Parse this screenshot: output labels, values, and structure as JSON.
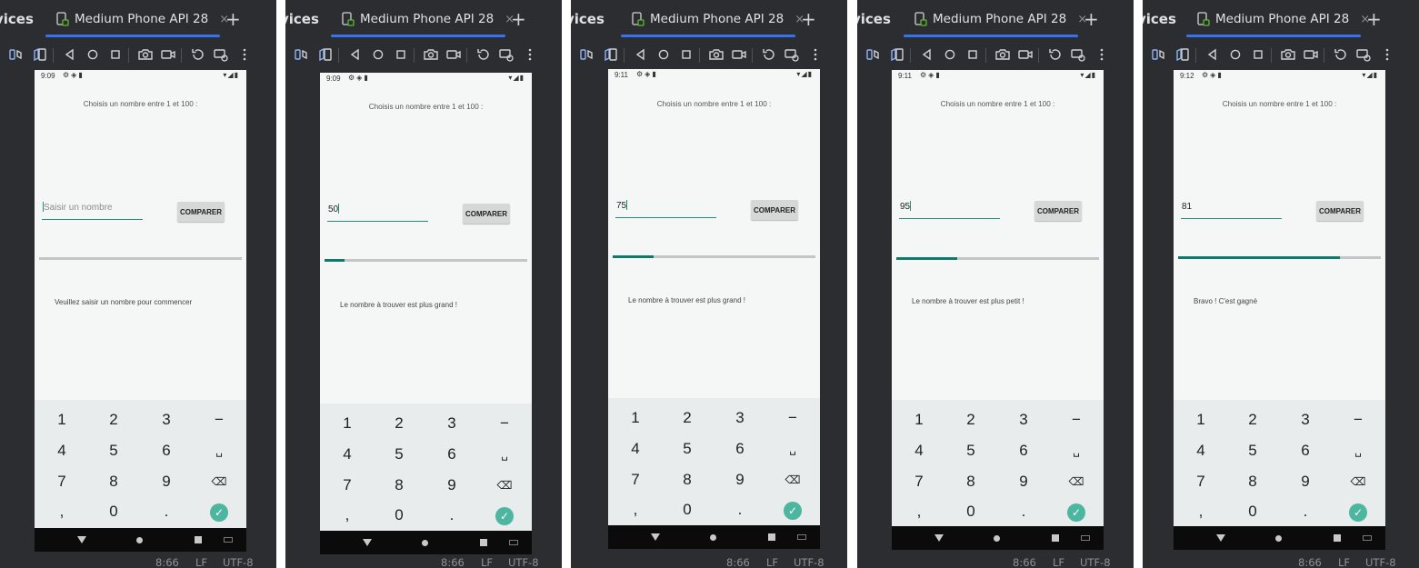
{
  "window": {
    "devices_label": "vices",
    "tab_title": "Medium Phone API 28",
    "tab_close": "×",
    "tab_add": "+"
  },
  "toolbar_icons": [
    "fold-icon",
    "unfold-icon",
    "back-icon",
    "home-icon",
    "overview-icon",
    "screenshot-icon",
    "screen-record-icon",
    "rotate-icon",
    "snapshot-icon",
    "more-icon"
  ],
  "statusbar": {
    "position": "8:66",
    "line_separator": "LF",
    "encoding": "UTF-8"
  },
  "app": {
    "prompt": "Choisis un nombre entre 1 et 100 :",
    "placeholder": "Saisir un nombre",
    "button_label": "COMPARER"
  },
  "keypad": {
    "rows": [
      [
        "1",
        "2",
        "3",
        "−"
      ],
      [
        "4",
        "5",
        "6",
        "␣"
      ],
      [
        "7",
        "8",
        "9",
        "⌫"
      ],
      [
        ",",
        "0",
        ".",
        "✓"
      ]
    ]
  },
  "panels": [
    {
      "time": "9:09",
      "input_value": "",
      "message": "Veuillez saisir un nombre pour commencer",
      "progress": 0.0
    },
    {
      "time": "9:09",
      "input_value": "50",
      "message": "Le nombre à trouver est plus grand !",
      "progress": 0.1
    },
    {
      "time": "9:11",
      "input_value": "75",
      "message": "Le nombre à trouver est plus grand !",
      "progress": 0.2
    },
    {
      "time": "9:11",
      "input_value": "95",
      "message": "Le nombre à trouver est plus petit !",
      "progress": 0.3
    },
    {
      "time": "9:12",
      "input_value": "81",
      "message": "Bravo ! C'est gagné",
      "progress": 0.8
    }
  ],
  "colors": {
    "accent": "#1f8f7a",
    "progress_fill": "#0f7a6a",
    "tab_underline": "#3574f0",
    "ide_bg": "#2b2d30",
    "key_done": "#4db6a0"
  }
}
